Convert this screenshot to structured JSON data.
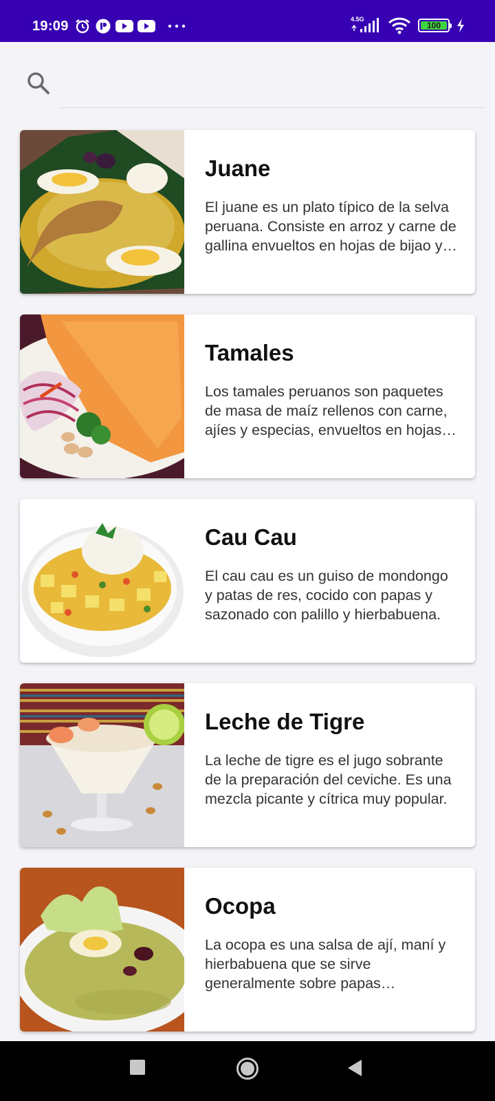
{
  "status_bar": {
    "time": "19:09",
    "network_type": "4.5G",
    "battery_level": "100",
    "icons": [
      "alarm-icon",
      "app-notification-icon",
      "youtube-icon",
      "youtube-icon",
      "more-icon",
      "signal-icon",
      "wifi-icon",
      "battery-icon",
      "charging-icon"
    ]
  },
  "search": {
    "placeholder": "",
    "value": ""
  },
  "dishes": [
    {
      "title": "Juane",
      "description": "El juane es un plato típico de la selva peruana. Consiste en arroz y carne de gallina envueltos en hojas de bijao y cocidos."
    },
    {
      "title": "Tamales",
      "description": "Los tamales peruanos son paquetes de masa de maíz rellenos con carne, ajíes y especias, envueltos en hojas de plátano."
    },
    {
      "title": "Cau Cau",
      "description": "El cau cau es un guiso de mondongo y patas de res, cocido con papas y sazonado con palillo y hierbabuena."
    },
    {
      "title": "Leche de Tigre",
      "description": "La leche de tigre es el jugo sobrante de la preparación del ceviche. Es una mezcla picante y cítrica muy popular."
    },
    {
      "title": "Ocopa",
      "description": "La ocopa es una salsa de ají, maní y hierbabuena que se sirve generalmente sobre papas sancochadas."
    }
  ],
  "nav_bar": {
    "buttons": [
      "recents-button",
      "home-button",
      "back-button"
    ]
  },
  "colors": {
    "status_bar": "#3700b3",
    "background": "#f4f4f8",
    "card": "#ffffff",
    "battery_fill": "#3fd33f"
  }
}
